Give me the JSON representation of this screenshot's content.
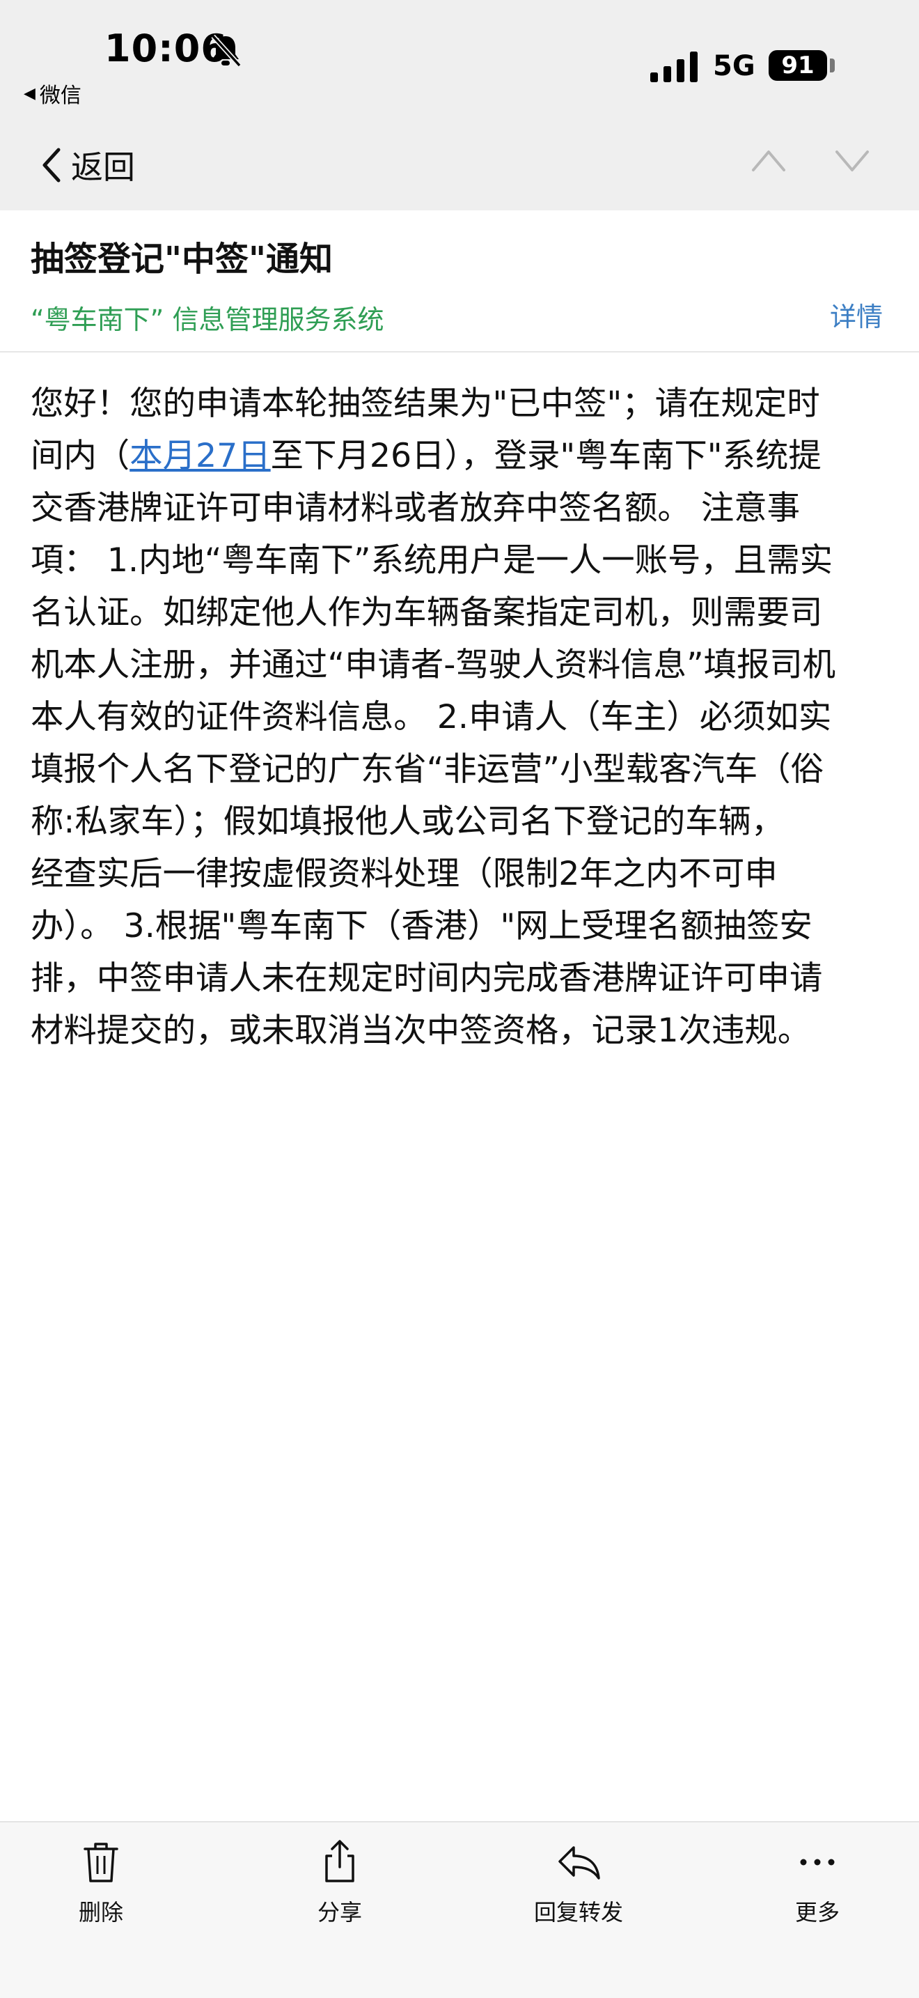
{
  "status_bar": {
    "time": "10:06",
    "back_app": "微信",
    "network": "5G",
    "battery": "91"
  },
  "nav": {
    "back_label": "返回"
  },
  "mail": {
    "subject": "抽签登记\"中签\"通知",
    "sender": "“粤车南下” 信息管理服务系统",
    "details": "详情",
    "body": {
      "l1": "您好！您的申请本轮抽签结果为\"已中签\"；请在规定时",
      "l2_pre": "间内（",
      "l2_link": "本月27日",
      "l2_post": "至下月26日），登录\"粤车南下\"系统提",
      "l3": "交香港牌证许可申请材料或者放弃中签名额。 注意事",
      "l4": "項： 1.内地“粤车南下”系统用户是一人一账号，且需实",
      "l5": "名认证。如绑定他人作为车辆备案指定司机，则需要司",
      "l6": "机本人注册，并通过“申请者-驾驶人资料信息”填报司机",
      "l7": "本人有效的证件资料信息。 2.申请人（车主）必须如实",
      "l8": "填报个人名下登记的广东省“非运营”小型载客汽车（俗",
      "l9": "称:私家车）；假如填报他人或公司名下登记的车辆，",
      "l10": "经查实后一律按虚假资料处理（限制2年之内不可申",
      "l11": "办）。 3.根据\"粤车南下（香港）\"网上受理名额抽签安",
      "l12": "排，中签申请人未在规定时间内完成香港牌证许可申请",
      "l13": "材料提交的，或未取消当次中签资格，记录1次违规。"
    }
  },
  "toolbar": {
    "delete": "删除",
    "share": "分享",
    "reply_forward": "回复转发",
    "more": "更多"
  },
  "colors": {
    "sender_green": "#2f9e54",
    "link_blue": "#2a6fc9",
    "details_blue": "#3d7fc4",
    "top_bg": "#efefef"
  },
  "icons": [
    "bell-slash-icon",
    "signal-icon",
    "chevron-left-icon",
    "chevron-up-icon",
    "chevron-down-icon",
    "trash-icon",
    "share-icon",
    "reply-icon",
    "more-icon"
  ]
}
